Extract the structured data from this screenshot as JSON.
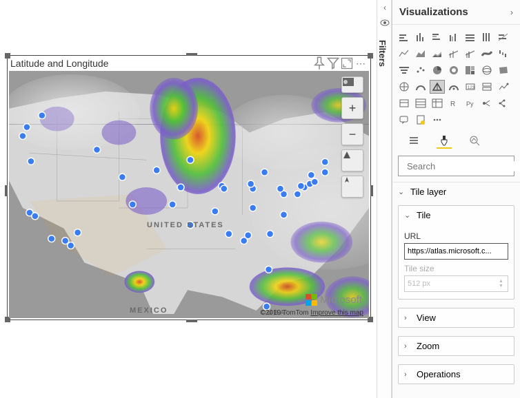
{
  "visual": {
    "title": "Latitude and Longitude",
    "header_icons": [
      "pin-icon",
      "filter-icon",
      "focus-icon",
      "more-icon"
    ]
  },
  "map": {
    "countries": {
      "usa": "UNITED STATES",
      "mexico": "MEXICO",
      "cuba": "CUBA"
    },
    "attribution": "©2019 TomTom ",
    "improve_link": "Improve this map",
    "microsoft_label": "Microsoft",
    "controls": [
      "layers-icon",
      "zoom-in-icon",
      "zoom-out-icon",
      "pitch-icon",
      "compass-icon"
    ]
  },
  "filters_strip": {
    "label": "Filters"
  },
  "right": {
    "title": "Visualizations",
    "search_placeholder": "Search",
    "viz_names": [
      [
        "stacked-bar",
        "stacked-column",
        "clustered-bar",
        "clustered-column",
        "100-stacked-bar",
        "100-stacked-column",
        "stacked-bar-line"
      ],
      [
        "line",
        "area",
        "stacked-area",
        "line-stacked-col",
        "line-clustered-col",
        "ribbon",
        "waterfall"
      ],
      [
        "funnel",
        "scatter",
        "pie",
        "donut",
        "treemap",
        "map",
        "filled-map"
      ],
      [
        "shape-map",
        "gauge",
        "azure-map",
        "arcgis",
        "card",
        "multi-row-card",
        "kpi"
      ],
      [
        "slicer",
        "table",
        "matrix",
        "r",
        "python",
        "key-influencers",
        "decomposition"
      ],
      [
        "qa",
        "paginated",
        "more"
      ]
    ],
    "viz_selected": [
      3,
      2
    ],
    "tools": [
      "fields-icon",
      "format-icon",
      "analytics-icon"
    ],
    "tool_selected": 1,
    "sections": {
      "tile_layer": "Tile layer",
      "view": "View",
      "zoom": "Zoom",
      "operations": "Operations"
    },
    "tile_card": {
      "title": "Tile",
      "url_label": "URL",
      "url_value": "https://atlas.microsoft.c...",
      "size_label": "Tile size",
      "size_value": "512 px"
    }
  }
}
